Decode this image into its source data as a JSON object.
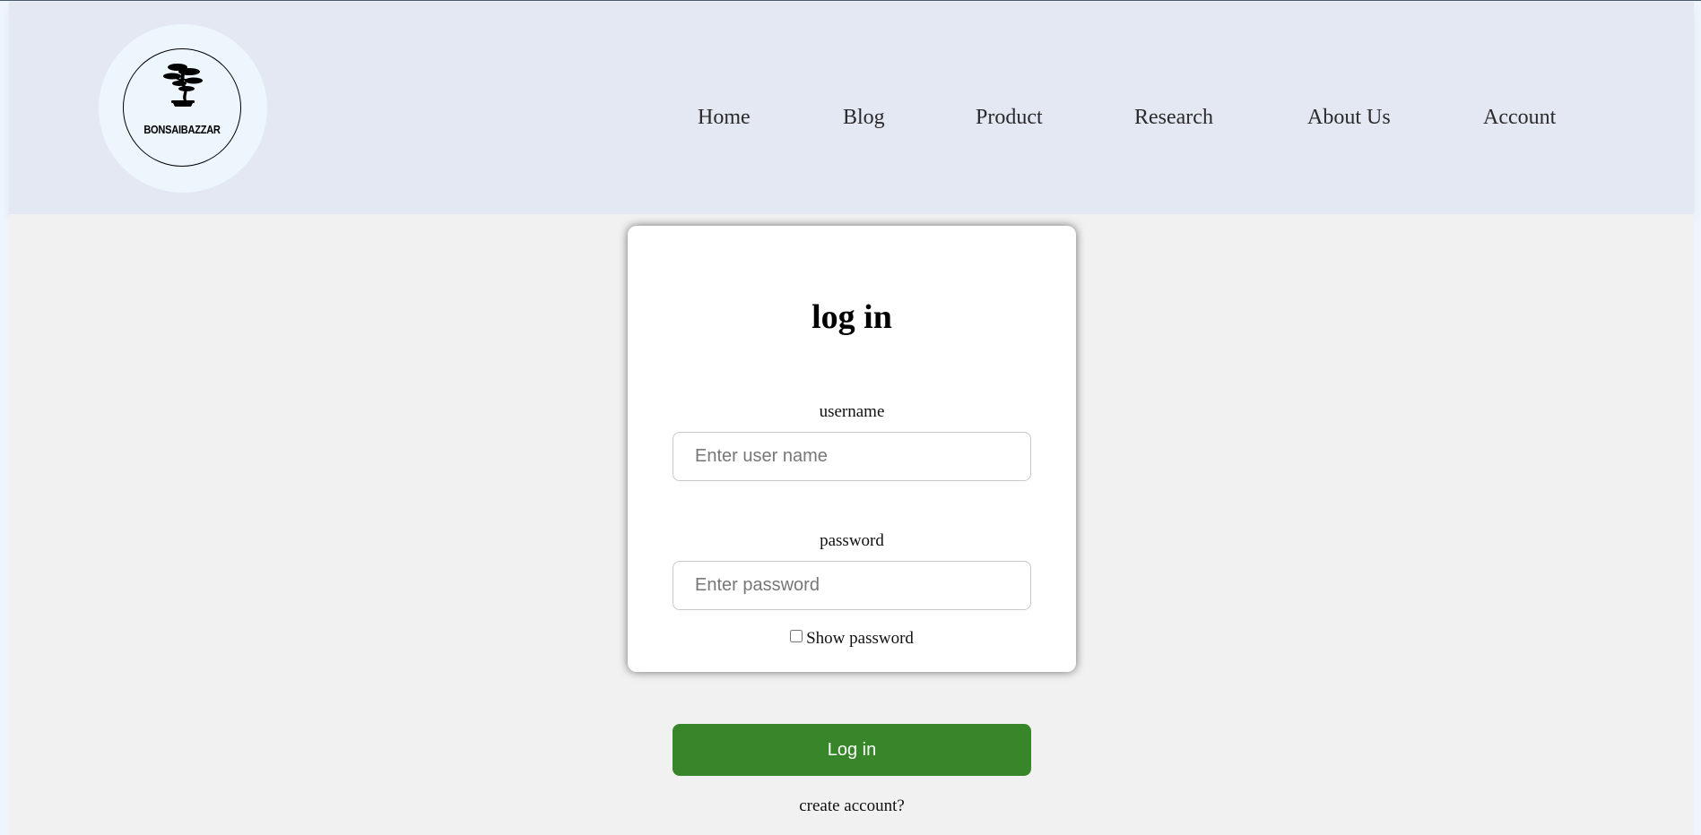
{
  "logo": {
    "icon": "bonsai-tree-icon",
    "text": "BONSAIBAZZAR"
  },
  "nav": {
    "items": [
      {
        "label": "Home"
      },
      {
        "label": "Blog"
      },
      {
        "label": "Product"
      },
      {
        "label": "Research"
      },
      {
        "label": "About Us"
      },
      {
        "label": "Account"
      }
    ]
  },
  "login": {
    "title": "log in",
    "username_label": "username",
    "username_placeholder": "Enter user name",
    "password_label": "password",
    "password_placeholder": "Enter password",
    "show_password_label": "Show password",
    "show_password_checked": false,
    "submit_label": "Log in",
    "create_account_label": "create account?"
  },
  "colors": {
    "header_bg": "#e3e8f3",
    "page_bg": "#f1f1f1",
    "button_green": "#378629",
    "card_bg": "#ffffff"
  }
}
